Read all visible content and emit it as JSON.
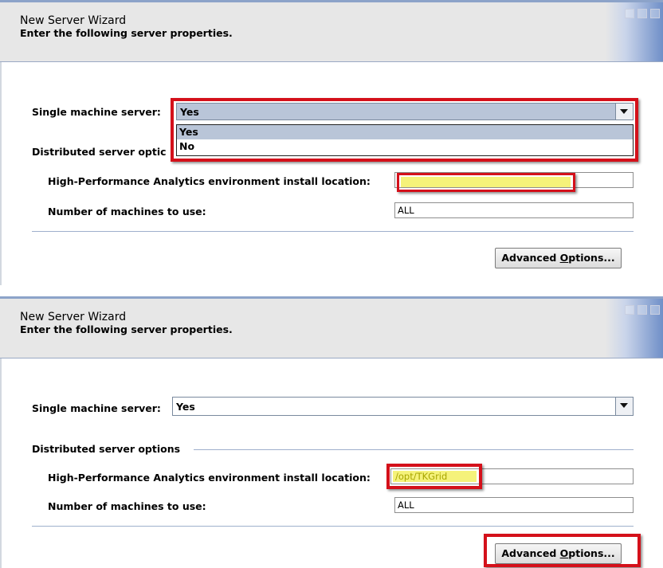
{
  "wizard": {
    "title": "New Server Wizard",
    "subtitle": "Enter the following server properties."
  },
  "fields": {
    "single_machine_label": "Single machine server:",
    "single_machine_value": "Yes",
    "dropdown_options": [
      "Yes",
      "No"
    ],
    "distributed_group_label": "Distributed server options",
    "distributed_group_label_truncated": "Distributed server optic",
    "install_location_label": "High-Performance Analytics environment install location:",
    "install_location_value_before": "",
    "install_location_value_after": "/opt/TKGrid",
    "machines_label": "Number of machines to use:",
    "machines_value": "ALL"
  },
  "buttons": {
    "advanced_prefix": "Advanced ",
    "advanced_mnemonic": "O",
    "advanced_suffix": "ptions..."
  },
  "colors": {
    "annotation_red": "#d4101a",
    "highlight_yellow": "#f5f27a",
    "combo_selected": "#b9c5d8"
  }
}
